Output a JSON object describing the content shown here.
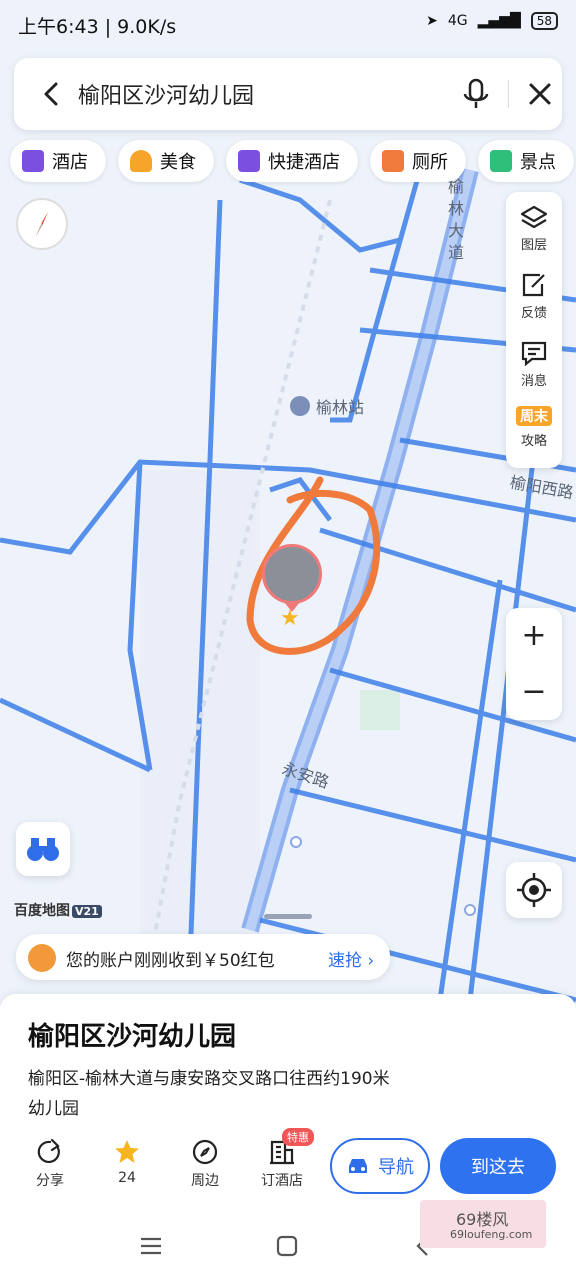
{
  "status_bar": {
    "time": "上午6:43 | 9.0K/s",
    "battery": "58",
    "network": "4G"
  },
  "search": {
    "query": "榆阳区沙河幼儿园"
  },
  "categories": [
    {
      "label": "酒店",
      "color": "#7b4fe0"
    },
    {
      "label": "美食",
      "color": "#f6a52a"
    },
    {
      "label": "快捷酒店",
      "color": "#7b4fe0"
    },
    {
      "label": "厕所",
      "color": "#f07a3c"
    },
    {
      "label": "景点",
      "color": "#2fbf7a"
    }
  ],
  "toolbar": {
    "layers": "图层",
    "feedback": "反馈",
    "messages": "消息",
    "weekend": "攻略",
    "weekend_badge": "周末"
  },
  "map": {
    "labels": {
      "yulin_station": "榆林站",
      "yulin_avenue": "榆林大道",
      "yuyang_west": "榆阳西路",
      "yongan_road": "永安路"
    },
    "brand": "百度地图",
    "version": "V21"
  },
  "zoom": {
    "in": "+",
    "out": "−"
  },
  "promo": {
    "text": "您的账户刚刚收到￥50红包",
    "link": "速抢"
  },
  "place": {
    "title": "榆阳区沙河幼儿园",
    "address": "榆阳区-榆林大道与康安路交叉路口往西约190米",
    "category": "幼儿园"
  },
  "actions": {
    "share": "分享",
    "favorite": "24",
    "nearby": "周边",
    "book_hotel": "订酒店",
    "special_badge": "特惠",
    "navigate": "导航",
    "go_here": "到这去"
  },
  "watermark": {
    "text": "69楼风",
    "url": "69loufeng.com"
  }
}
